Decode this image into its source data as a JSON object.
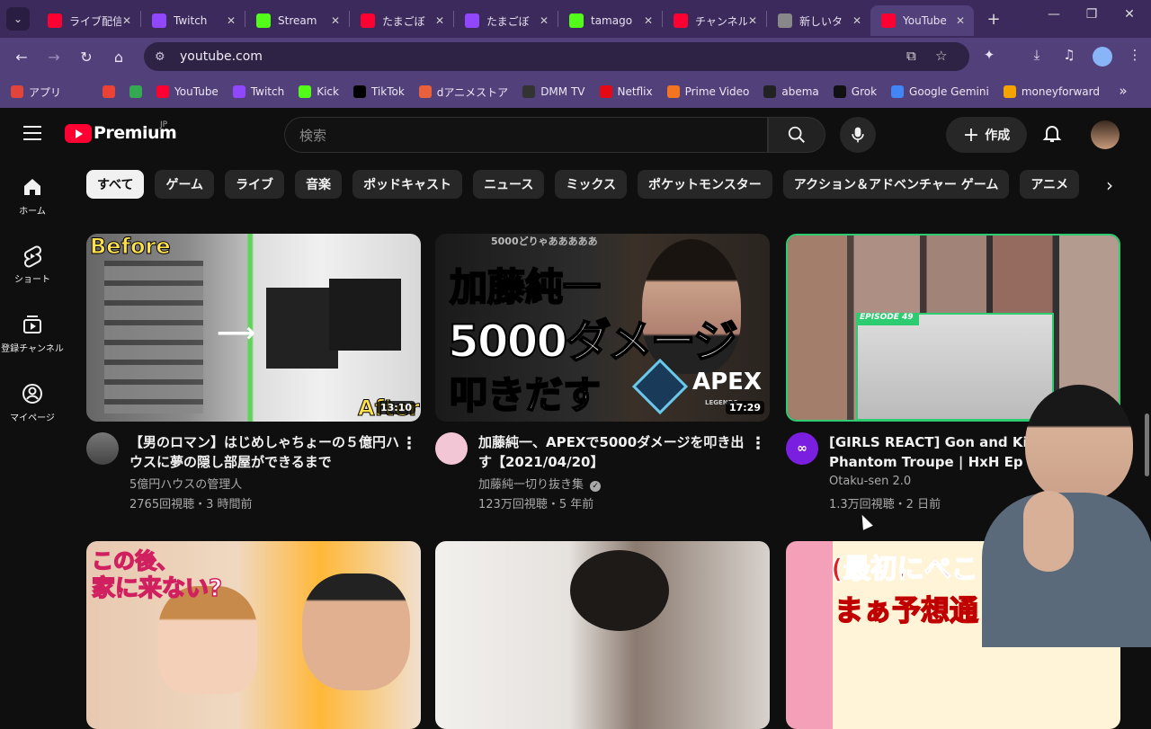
{
  "browser": {
    "tabs": [
      {
        "title": "ライブ配信",
        "icon": "youtube-icon",
        "color": "#ff0033"
      },
      {
        "title": "Twitch",
        "icon": "twitch-icon",
        "color": "#9146ff"
      },
      {
        "title": "Stream",
        "icon": "kick-icon",
        "color": "#53fc18"
      },
      {
        "title": "たまごぼ",
        "icon": "youtube-icon",
        "color": "#ff0033"
      },
      {
        "title": "たまごぼ",
        "icon": "twitch-icon",
        "color": "#9146ff"
      },
      {
        "title": "tamago",
        "icon": "kick-icon",
        "color": "#53fc18"
      },
      {
        "title": "チャンネル",
        "icon": "youtube-icon",
        "color": "#ff0033"
      },
      {
        "title": "新しいタ",
        "icon": "chrome-icon",
        "color": "#888888"
      },
      {
        "title": "YouTube",
        "icon": "youtube-icon",
        "color": "#ff0033",
        "active": true
      }
    ],
    "url": "youtube.com",
    "bookmarks": [
      {
        "label": "アプリ",
        "icon": "apps-icon",
        "color": "#e0443a"
      },
      {
        "label": "",
        "icon": "grid-icon",
        "color": "#52407a"
      },
      {
        "label": "",
        "icon": "gmail-icon",
        "color": "#ea4335"
      },
      {
        "label": "",
        "icon": "pinwheel-icon",
        "color": "#34a853"
      },
      {
        "label": "YouTube",
        "icon": "youtube-icon",
        "color": "#ff0033"
      },
      {
        "label": "Twitch",
        "icon": "twitch-icon",
        "color": "#9146ff"
      },
      {
        "label": "Kick",
        "icon": "kick-icon",
        "color": "#53fc18"
      },
      {
        "label": "TikTok",
        "icon": "tiktok-icon",
        "color": "#000000"
      },
      {
        "label": "dアニメストア",
        "icon": "danime-icon",
        "color": "#e8613c"
      },
      {
        "label": "DMM TV",
        "icon": "dmm-icon",
        "color": "#333333"
      },
      {
        "label": "Netflix",
        "icon": "netflix-icon",
        "color": "#e50914"
      },
      {
        "label": "Prime Video",
        "icon": "prime-icon",
        "color": "#f47521"
      },
      {
        "label": "abema",
        "icon": "abema-icon",
        "color": "#222222"
      },
      {
        "label": "Grok",
        "icon": "grok-icon",
        "color": "#111111"
      },
      {
        "label": "Google Gemini",
        "icon": "gemini-icon",
        "color": "#4285f4"
      },
      {
        "label": "moneyforward",
        "icon": "moneyforward-icon",
        "color": "#f5a300"
      }
    ]
  },
  "youtube": {
    "brand": "Premium",
    "country": "JP",
    "search_placeholder": "検索",
    "create_label": "作成",
    "chips": [
      "すべて",
      "ゲーム",
      "ライブ",
      "音楽",
      "ポッドキャスト",
      "ニュース",
      "ミックス",
      "ポケットモンスター",
      "アクション＆アドベンチャー ゲーム",
      "アニメ"
    ],
    "sidebar": [
      {
        "label": "ホーム",
        "icon": "home-icon"
      },
      {
        "label": "ショート",
        "icon": "shorts-icon"
      },
      {
        "label": "登録チャンネル",
        "icon": "subscriptions-icon"
      },
      {
        "label": "マイページ",
        "icon": "you-icon"
      }
    ],
    "videos": [
      {
        "title": "【男のロマン】はじめしゃちょーの５億円ハウスに夢の隠し部屋ができるまで",
        "channel": "5億円ハウスの管理人",
        "stats": "2765回視聴・3 時間前",
        "duration": "13:10",
        "thumb_text": [
          "Before",
          "After"
        ]
      },
      {
        "title": "加藤純一、APEXで5000ダメージを叩き出す【2021/04/20】",
        "channel": "加藤純一切り抜き集",
        "verified": true,
        "stats": "123万回視聴・5 年前",
        "duration": "17:29",
        "thumb_text": [
          "加藤純一",
          "5000ダメージ",
          "叩きだす",
          "APEX",
          "5000どりゃあああああ",
          "LEGENDS"
        ]
      },
      {
        "title": "[GIRLS REACT] Gon and Killua face Phantom Troupe | HxH Ep 49 Girls",
        "channel": "Otaku-sen 2.0",
        "stats": "1.3万回視聴・2 日前",
        "thumb_text": [
          "EPISODE 49"
        ]
      },
      {
        "thumb_text": [
          "この後、",
          "家に来ない?"
        ]
      },
      {
        "thumb_text": []
      },
      {
        "thumb_text": [
          "(最初にぺこ",
          "まぁ予想通"
        ]
      }
    ]
  }
}
